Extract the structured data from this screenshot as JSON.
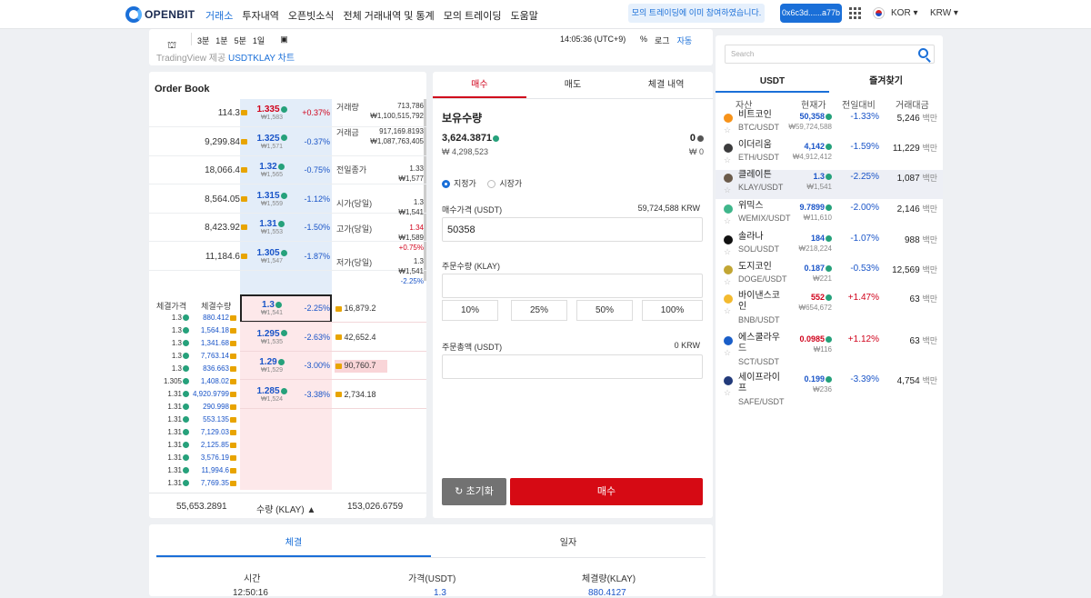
{
  "header": {
    "logo": "OPENBIT",
    "nav": [
      "거래소",
      "투자내역",
      "오픈빗소식",
      "전체 거래내역 및 통계",
      "모의 트레이딩",
      "도움말"
    ],
    "banner": "모의 트레이딩에 이미 참여하였습니다.",
    "wallet": "0x6c3d......a77b",
    "lang": "KOR ▾",
    "currency": "KRW ▾"
  },
  "chart": {
    "intervals": [
      "3분",
      "1분",
      "5분",
      "1일"
    ],
    "clock": "14:05:36 (UTC+9)",
    "options": [
      "%",
      "로그",
      "자동"
    ],
    "source_prefix": "TradingView 제공",
    "source_link": "USDTKLAY 차트"
  },
  "orderbook": {
    "title": "Order Book",
    "asks": [
      {
        "vol": "114.3",
        "price": "1.335",
        "krw": "₩1,583",
        "pct": "+0.37%",
        "pct_color": "red"
      },
      {
        "vol": "9,299.84",
        "price": "1.325",
        "krw": "₩1,571",
        "pct": "-0.37%",
        "pct_color": "blue"
      },
      {
        "vol": "18,066.4",
        "price": "1.32",
        "krw": "₩1,565",
        "pct": "-0.75%",
        "pct_color": "blue"
      },
      {
        "vol": "8,564.05",
        "price": "1.315",
        "krw": "₩1,559",
        "pct": "-1.12%",
        "pct_color": "blue"
      },
      {
        "vol": "8,423.92",
        "price": "1.31",
        "krw": "₩1,553",
        "pct": "-1.50%",
        "pct_color": "blue"
      },
      {
        "vol": "11,184.6",
        "price": "1.305",
        "krw": "₩1,547",
        "pct": "-1.87%",
        "pct_color": "blue"
      }
    ],
    "bids": [
      {
        "price": "1.3",
        "krw": "₩1,541",
        "pct": "-2.25%",
        "vol": "16,879.2"
      },
      {
        "price": "1.295",
        "krw": "₩1,535",
        "pct": "-2.63%",
        "vol": "42,652.4"
      },
      {
        "price": "1.29",
        "krw": "₩1,529",
        "pct": "-3.00%",
        "vol": "90,760.7"
      },
      {
        "price": "1.285",
        "krw": "₩1,524",
        "pct": "-3.38%",
        "vol": "2,734.18"
      }
    ],
    "info": [
      {
        "k": "거래량",
        "v": "713,786",
        "v2": "₩1,100,515,792"
      },
      {
        "k": "거래금",
        "v": "917,169.8193",
        "v2": "₩1,087,763,405"
      },
      {
        "k": "전일종가",
        "v": "1.33",
        "v2": "₩1,577"
      },
      {
        "k": "시가(당일)",
        "v": "1.3",
        "v2": "₩1,541"
      },
      {
        "k": "고가(당일)",
        "v": "1.34",
        "v2": "₩1,589",
        "v3": "+0.75%"
      },
      {
        "k": "저가(당일)",
        "v": "1.3",
        "v2": "₩1,541",
        "v3": "-2.25%"
      }
    ],
    "trade_head": [
      "체결가격",
      "체결수량"
    ],
    "trades": [
      [
        "1.3",
        "880.412"
      ],
      [
        "1.3",
        "1,564.18"
      ],
      [
        "1.3",
        "1,341.68"
      ],
      [
        "1.3",
        "7,763.14"
      ],
      [
        "1.3",
        "836.663"
      ],
      [
        "1.305",
        "1,408.02"
      ],
      [
        "1.31",
        "4,920.9799"
      ],
      [
        "1.31",
        "290.998"
      ],
      [
        "1.31",
        "553.135"
      ],
      [
        "1.31",
        "7,129.03"
      ],
      [
        "1.31",
        "2,125.85"
      ],
      [
        "1.31",
        "3,576.19"
      ],
      [
        "1.31",
        "11,994.6"
      ],
      [
        "1.31",
        "7,769.35"
      ]
    ],
    "footer": {
      "left": "55,653.2891",
      "mid": "수량 (KLAY) ▲",
      "right": "153,026.6759"
    }
  },
  "form": {
    "tabs": [
      "매수",
      "매도",
      "체결 내역"
    ],
    "holdings_label": "보유수량",
    "usdt_amt": "3,624.3871",
    "usdt_krw": "₩ 4,298,523",
    "klay_amt": "0",
    "klay_krw": "₩ 0",
    "limit": "지정가",
    "market": "시장가",
    "price_label": "매수가격 (USDT)",
    "price_krw": "59,724,588 KRW",
    "price_value": "50358",
    "qty_label": "주문수량 (KLAY)",
    "pcts": [
      "10%",
      "25%",
      "50%",
      "100%"
    ],
    "total_label": "주문총액 (USDT)",
    "total_krw": "0 KRW",
    "reset": "초기화",
    "buy": "매수"
  },
  "history": {
    "tabs": [
      "체결",
      "일자"
    ],
    "cols": [
      "시간",
      "가격(USDT)",
      "체결량(KLAY)"
    ],
    "row": [
      "12:50:16",
      "1.3",
      "880.4127"
    ]
  },
  "market": {
    "search": "Search",
    "tabs": [
      "USDT",
      "즐겨찾기"
    ],
    "cols": [
      "자산",
      "현재가",
      "전일대비",
      "거래대금"
    ],
    "rows": [
      {
        "name": "비트코인",
        "sym": "BTC/USDT",
        "price": "50,358",
        "krw": "₩59,724,588",
        "chg": "-1.33%",
        "vol": "5,246",
        "unit": "백만",
        "color": "#f7931a",
        "pc": "blue"
      },
      {
        "name": "이더리움",
        "sym": "ETH/USDT",
        "price": "4,142",
        "krw": "₩4,912,412",
        "chg": "-1.59%",
        "vol": "11,229",
        "unit": "백만",
        "color": "#3c3c3d",
        "pc": "blue"
      },
      {
        "name": "클레이튼",
        "sym": "KLAY/USDT",
        "price": "1.3",
        "krw": "₩1,541",
        "chg": "-2.25%",
        "vol": "1,087",
        "unit": "백만",
        "color": "#6b5b4b",
        "pc": "blue"
      },
      {
        "name": "위믹스",
        "sym": "WEMIX/USDT",
        "price": "9.7899",
        "krw": "₩11,610",
        "chg": "-2.00%",
        "vol": "2,146",
        "unit": "백만",
        "color": "#3fb68b",
        "pc": "blue"
      },
      {
        "name": "솔라나",
        "sym": "SOL/USDT",
        "price": "184",
        "krw": "₩218,224",
        "chg": "-1.07%",
        "vol": "988",
        "unit": "백만",
        "color": "#111",
        "pc": "blue"
      },
      {
        "name": "도지코인",
        "sym": "DOGE/USDT",
        "price": "0.187",
        "krw": "₩221",
        "chg": "-0.53%",
        "vol": "12,569",
        "unit": "백만",
        "color": "#c2a633",
        "pc": "blue"
      },
      {
        "name": "바이낸스코인",
        "sym": "BNB/USDT",
        "price": "552",
        "krw": "₩654,672",
        "chg": "+1.47%",
        "vol": "63",
        "unit": "백만",
        "color": "#f3ba2f",
        "pc": "red"
      },
      {
        "name": "에스쿨라우드",
        "sym": "SCT/USDT",
        "price": "0.0985",
        "krw": "₩116",
        "chg": "+1.12%",
        "vol": "63",
        "unit": "백만",
        "color": "#1a5ec8",
        "pc": "red"
      },
      {
        "name": "세이프라이프",
        "sym": "SAFE/USDT",
        "price": "0.199",
        "krw": "₩236",
        "chg": "-3.39%",
        "vol": "4,754",
        "unit": "백만",
        "color": "#223a7a",
        "pc": "blue"
      }
    ]
  }
}
